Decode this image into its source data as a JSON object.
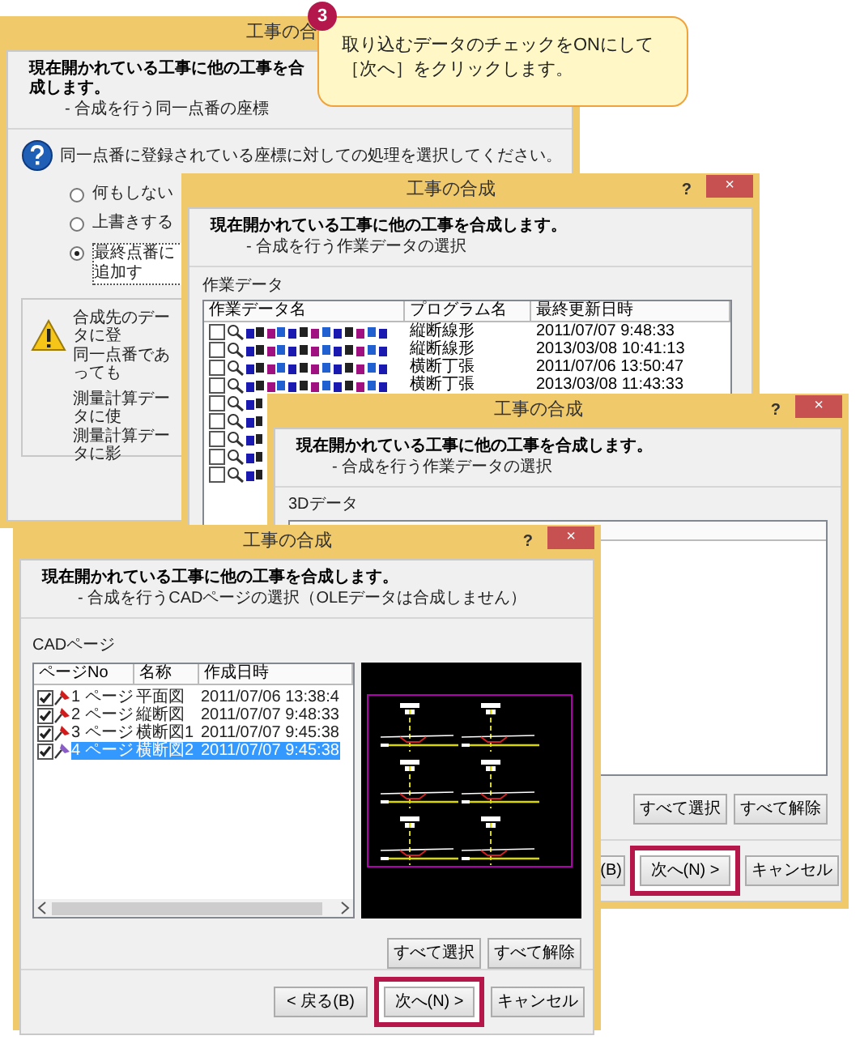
{
  "callout": {
    "step": "3",
    "lines": [
      "取り込むデータのチェックをONにして",
      "［次へ］をクリックします。"
    ]
  },
  "windows": [
    {
      "kind": "radios",
      "title": "工事の合",
      "heading": "現在開かれている工事に他の工事を合成します。",
      "subheading": "- 合成を行う同一点番の座標",
      "question": "同一点番に登録されている座標に対しての処理を選択してください。",
      "options": [
        {
          "label": "何もしない",
          "selected": false
        },
        {
          "label": "上書きする",
          "selected": false
        },
        {
          "label": "最終点番に追加す",
          "selected": true
        }
      ],
      "warning_lines": [
        "合成先のデータに登",
        "同一点番であっても",
        "測量計算データに使",
        "測量計算データに影"
      ]
    },
    {
      "kind": "worklist",
      "title": "工事の合成",
      "help": "?",
      "close": "×",
      "heading": "現在開かれている工事に他の工事を合成します。",
      "subheading": "- 合成を行う作業データの選択",
      "list_label": "作業データ",
      "columns": [
        "作業データ名",
        "プログラム名",
        "最終更新日時"
      ],
      "rows": [
        {
          "checked": false,
          "program": "縦断線形",
          "updated": "2011/07/07 9:48:33"
        },
        {
          "checked": false,
          "program": "縦断線形",
          "updated": "2013/03/08 10:41:13"
        },
        {
          "checked": false,
          "program": "横断丁張",
          "updated": "2011/07/06 13:50:47"
        },
        {
          "checked": false,
          "program": "横断丁張",
          "updated": "2013/03/08 11:43:33"
        },
        {
          "checked": false
        },
        {
          "checked": false
        },
        {
          "checked": false
        },
        {
          "checked": false
        },
        {
          "checked": false
        }
      ]
    },
    {
      "kind": "scenelist",
      "title": "工事の合成",
      "help": "?",
      "close": "×",
      "heading": "現在開かれている工事に他の工事を合成します。",
      "subheading": "- 合成を行う作業データの選択",
      "list_label": "3Dデータ",
      "buttons": [
        "すべて選択",
        "すべて解除"
      ],
      "footer_buttons": [
        {
          "label": "(B)",
          "highlighted": false
        },
        {
          "label": "次へ(N) >",
          "highlighted": true
        },
        {
          "label": "キャンセル",
          "highlighted": false
        }
      ]
    },
    {
      "kind": "cadpages",
      "title": "工事の合成",
      "help": "?",
      "close": "×",
      "heading": "現在開かれている工事に他の工事を合成します。",
      "subheading": "- 合成を行うCADページの選択（OLEデータは合成しません）",
      "list_label": "CADページ",
      "columns": [
        "ページNo",
        "名称",
        "作成日時"
      ],
      "rows": [
        {
          "checked": true,
          "selected": false,
          "page": "1 ページ",
          "name": "平面図",
          "created": "2011/07/06 13:38:4"
        },
        {
          "checked": true,
          "selected": false,
          "page": "2 ページ",
          "name": "縦断図",
          "created": "2011/07/07 9:48:33"
        },
        {
          "checked": true,
          "selected": false,
          "page": "3 ページ",
          "name": "横断図1",
          "created": "2011/07/07 9:45:38"
        },
        {
          "checked": true,
          "selected": true,
          "page": "4 ページ",
          "name": "横断図2",
          "created": "2011/07/07 9:45:38"
        }
      ],
      "buttons": [
        "すべて選択",
        "すべて解除"
      ],
      "footer_buttons": [
        {
          "label": "< 戻る(B)",
          "highlighted": false
        },
        {
          "label": "次へ(N) >",
          "highlighted": true
        },
        {
          "label": "キャンセル",
          "highlighted": false
        }
      ]
    }
  ]
}
